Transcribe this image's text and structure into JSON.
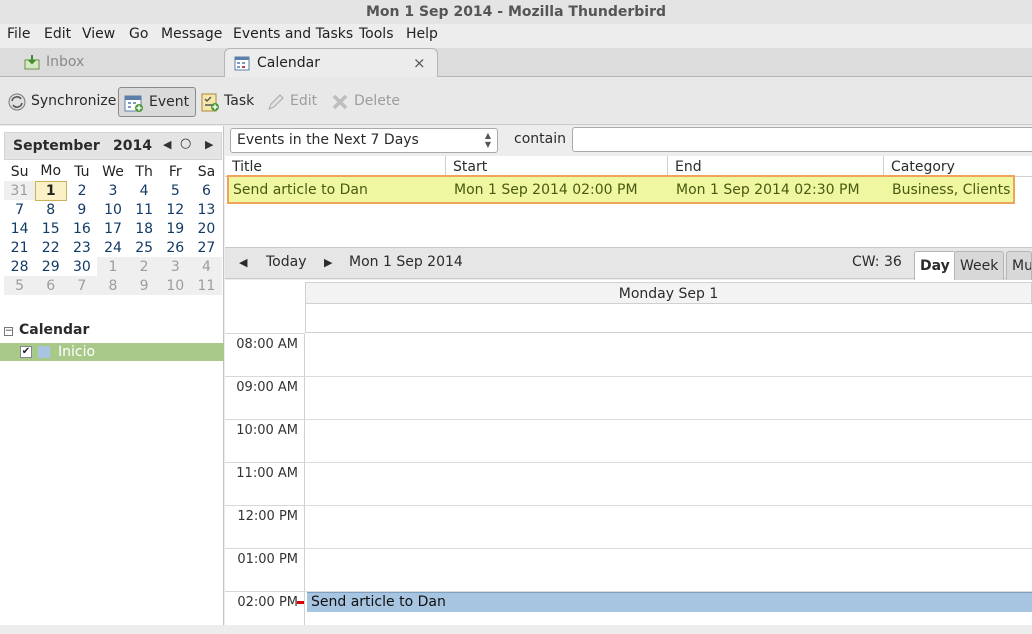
{
  "window": {
    "title": "Mon 1 Sep 2014 - Mozilla Thunderbird"
  },
  "menu": [
    "File",
    "Edit",
    "View",
    "Go",
    "Message",
    "Events and Tasks",
    "Tools",
    "Help"
  ],
  "tabs": {
    "inbox": "Inbox",
    "calendar": "Calendar",
    "close_glyph": "×"
  },
  "toolbar": {
    "synchronize": "Synchronize",
    "event": "Event",
    "task": "Task",
    "edit": "Edit",
    "delete": "Delete"
  },
  "minical": {
    "month": "September",
    "year": "2014",
    "weekdays": [
      "Su",
      "Mo",
      "Tu",
      "We",
      "Th",
      "Fr",
      "Sa"
    ],
    "weeks": [
      [
        "31",
        "1",
        "2",
        "3",
        "4",
        "5",
        "6"
      ],
      [
        "7",
        "8",
        "9",
        "10",
        "11",
        "12",
        "13"
      ],
      [
        "14",
        "15",
        "16",
        "17",
        "18",
        "19",
        "20"
      ],
      [
        "21",
        "22",
        "23",
        "24",
        "25",
        "26",
        "27"
      ],
      [
        "28",
        "29",
        "30",
        "1",
        "2",
        "3",
        "4"
      ],
      [
        "5",
        "6",
        "7",
        "8",
        "9",
        "10",
        "11"
      ]
    ]
  },
  "calendars": {
    "header": "Calendar",
    "items": [
      {
        "name": "Inicio",
        "checked": true,
        "color": "#a7c4e0"
      }
    ]
  },
  "filter": {
    "selected": "Events in the Next 7 Days",
    "contain_label": "contain",
    "search_value": ""
  },
  "event_list": {
    "columns": [
      "Title",
      "Start",
      "End",
      "Category"
    ],
    "rows": [
      {
        "title": "Send article to Dan",
        "start": "Mon 1 Sep 2014 02:00 PM",
        "end": "Mon 1 Sep 2014 02:30 PM",
        "category": "Business, Clients"
      }
    ]
  },
  "day_nav": {
    "today": "Today",
    "date": "Mon 1 Sep 2014",
    "cw": "CW: 36",
    "views": [
      "Day",
      "Week",
      "Mu"
    ]
  },
  "day_view": {
    "header": "Monday Sep 1",
    "hours": [
      "08:00 AM",
      "09:00 AM",
      "10:00 AM",
      "11:00 AM",
      "12:00 PM",
      "01:00 PM",
      "02:00 PM"
    ],
    "event": "Send article to Dan"
  },
  "colors": {
    "selected_row_bg": "#eff7a0",
    "selected_row_border": "#f0a35a",
    "calendar_item_bg": "#a8c98a",
    "event_block": "#a7c4e0"
  }
}
